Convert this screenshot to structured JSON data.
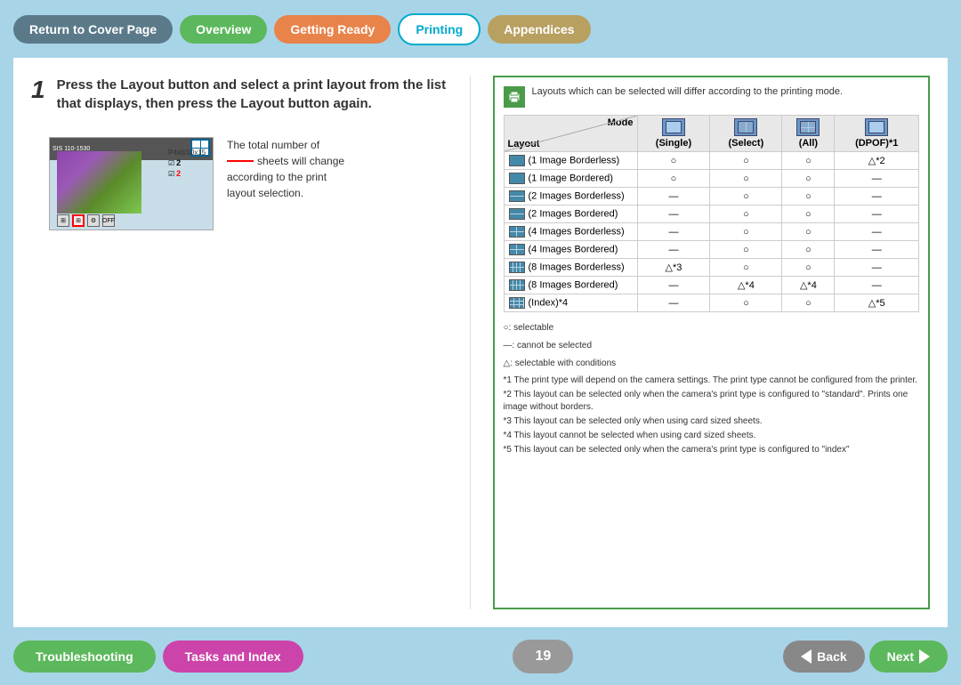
{
  "nav": {
    "return_label": "Return to Cover Page",
    "overview_label": "Overview",
    "getting_ready_label": "Getting Ready",
    "printing_label": "Printing",
    "appendices_label": "Appendices"
  },
  "step": {
    "number": "1",
    "text": "Press the Layout button and select a print layout from the list that displays, then press the Layout button again.",
    "description_line1": "The total number of",
    "description_line2": "sheets will change",
    "description_line3": "according to the print",
    "description_line4": "layout selection."
  },
  "table": {
    "header_note": "Layouts which can be selected will differ according to the printing mode.",
    "mode_label": "Mode",
    "layout_label": "Layout",
    "col_single": "(Single)",
    "col_select": "(Select)",
    "col_all": "(All)",
    "col_dpof": "(DPOF)*1",
    "rows": [
      {
        "name": "(1 Image Borderless)",
        "single": "○",
        "select": "○",
        "all": "○",
        "dpof": "△*2"
      },
      {
        "name": "(1 Image Bordered)",
        "single": "○",
        "select": "○",
        "all": "○",
        "dpof": "—"
      },
      {
        "name": "(2 Images Borderless)",
        "single": "—",
        "select": "○",
        "all": "○",
        "dpof": "—"
      },
      {
        "name": "(2 Images Bordered)",
        "single": "—",
        "select": "○",
        "all": "○",
        "dpof": "—"
      },
      {
        "name": "(4 Images Borderless)",
        "single": "—",
        "select": "○",
        "all": "○",
        "dpof": "—"
      },
      {
        "name": "(4 Images Bordered)",
        "single": "—",
        "select": "○",
        "all": "○",
        "dpof": "—"
      },
      {
        "name": "(8 Images Borderless)",
        "single": "△*3",
        "select": "○",
        "all": "○",
        "dpof": "—"
      },
      {
        "name": "(8 Images Bordered)",
        "single": "—",
        "select": "△*4",
        "all": "△*4",
        "dpof": "—"
      },
      {
        "name": "(Index)*4",
        "single": "—",
        "select": "○",
        "all": "○",
        "dpof": "△*5"
      }
    ],
    "legend": {
      "circle": "○: selectable",
      "dash": "—: cannot be selected",
      "triangle": "△: selectable with conditions"
    },
    "footnotes": [
      "*1 The print type will depend on the camera settings. The print type cannot be configured from the printer.",
      "*2 This layout can be selected only when the camera's print type is configured to \"standard\". Prints one image without borders.",
      "*3 This layout can be selected only when using card sized sheets.",
      "*4 This layout cannot be selected when using card sized sheets.",
      "*5 This layout can be selected only when the camera's print type is configured to \"index\""
    ]
  },
  "bottom": {
    "troubleshooting_label": "Troubleshooting",
    "tasks_label": "Tasks and Index",
    "page_number": "19",
    "back_label": "Back",
    "next_label": "Next"
  }
}
